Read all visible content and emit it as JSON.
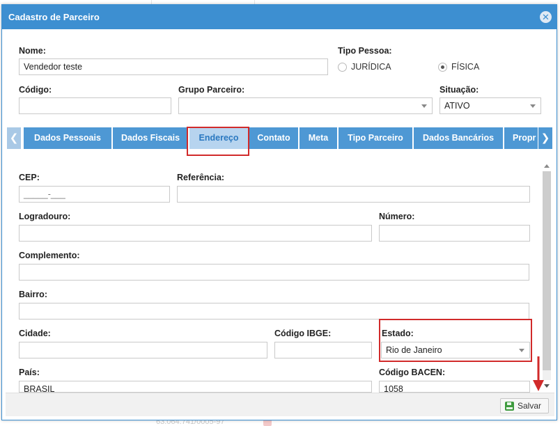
{
  "dialog": {
    "title": "Cadastro de Parceiro",
    "close_icon": "close-icon"
  },
  "header_fields": {
    "nome": {
      "label": "Nome:",
      "value": "Vendedor teste"
    },
    "tipo_pessoa": {
      "label": "Tipo Pessoa:",
      "options": [
        {
          "label": "JURÍDICA",
          "checked": false
        },
        {
          "label": "FÍSICA",
          "checked": true
        }
      ]
    },
    "codigo": {
      "label": "Código:",
      "value": ""
    },
    "grupo_parceiro": {
      "label": "Grupo Parceiro:",
      "value": ""
    },
    "situacao": {
      "label": "Situação:",
      "value": "ATIVO"
    }
  },
  "tabs": {
    "prev_icon": "❮",
    "next_icon": "❯",
    "items": [
      {
        "label": "Dados Pessoais",
        "active": false
      },
      {
        "label": "Dados Fiscais",
        "active": false
      },
      {
        "label": "Endereço",
        "active": true
      },
      {
        "label": "Contato",
        "active": false
      },
      {
        "label": "Meta",
        "active": false
      },
      {
        "label": "Tipo Parceiro",
        "active": false
      },
      {
        "label": "Dados Bancários",
        "active": false
      },
      {
        "label": "Propr",
        "active": false
      }
    ]
  },
  "endereco": {
    "cep": {
      "label": "CEP:",
      "value": "_____-___"
    },
    "referencia": {
      "label": "Referência:",
      "value": ""
    },
    "logradouro": {
      "label": "Logradouro:",
      "value": ""
    },
    "numero": {
      "label": "Número:",
      "value": ""
    },
    "complemento": {
      "label": "Complemento:",
      "value": ""
    },
    "bairro": {
      "label": "Bairro:",
      "value": ""
    },
    "cidade": {
      "label": "Cidade:",
      "value": ""
    },
    "codigo_ibge": {
      "label": "Código IBGE:",
      "value": ""
    },
    "estado": {
      "label": "Estado:",
      "value": "Rio de Janeiro"
    },
    "pais": {
      "label": "País:",
      "value": "BRASIL"
    },
    "codigo_bacen": {
      "label": "Código BACEN:",
      "value": "1058"
    }
  },
  "footer": {
    "save_label": "Salvar"
  },
  "background": {
    "partial_text": "63.064.741/0005-97"
  },
  "colors": {
    "accent": "#3d8fd1",
    "tab": "#4e98d4",
    "tab_active": "#b7d4ef",
    "highlight": "#d12a2a",
    "save_icon": "#3e9b3e"
  }
}
